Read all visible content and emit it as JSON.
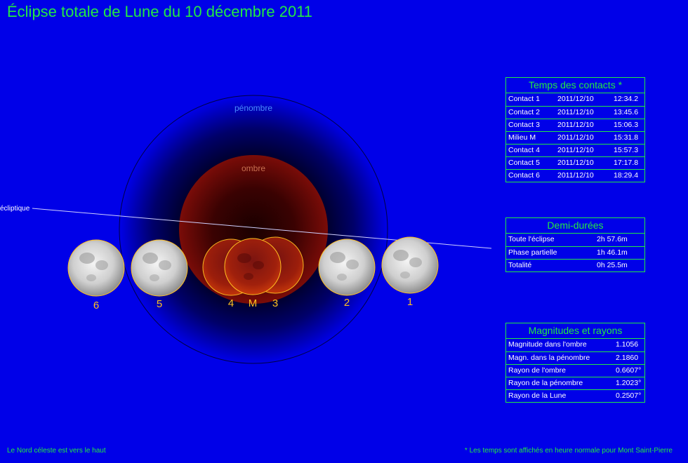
{
  "title": "Éclipse totale de Lune du 10 décembre 2011",
  "diagram": {
    "penumbra_label": "pénombre",
    "umbra_label": "ombre",
    "ecliptic_label": "écliptique",
    "moon_labels": [
      "6",
      "5",
      "4",
      "M",
      "3",
      "2",
      "1"
    ]
  },
  "contacts": {
    "title": "Temps des contacts *",
    "rows": [
      {
        "label": "Contact 1",
        "date": "2011/12/10",
        "time": "12:34.2"
      },
      {
        "label": "Contact 2",
        "date": "2011/12/10",
        "time": "13:45.6"
      },
      {
        "label": "Contact 3",
        "date": "2011/12/10",
        "time": "15:06.3"
      },
      {
        "label": "Milieu M",
        "date": "2011/12/10",
        "time": "15:31.8"
      },
      {
        "label": "Contact 4",
        "date": "2011/12/10",
        "time": "15:57.3"
      },
      {
        "label": "Contact 5",
        "date": "2011/12/10",
        "time": "17:17.8"
      },
      {
        "label": "Contact 6",
        "date": "2011/12/10",
        "time": "18:29.4"
      }
    ]
  },
  "durations": {
    "title": "Demi-durées",
    "rows": [
      {
        "label": "Toute l'éclipse",
        "value": "2h 57.6m"
      },
      {
        "label": "Phase partielle",
        "value": "1h 46.1m"
      },
      {
        "label": "Totalité",
        "value": "0h 25.5m"
      }
    ]
  },
  "magnitudes": {
    "title": "Magnitudes et rayons",
    "rows": [
      {
        "label": "Magnitude dans l'ombre",
        "value": "1.1056"
      },
      {
        "label": "Magn. dans la pénombre",
        "value": "2.1860"
      },
      {
        "label": "Rayon de l'ombre",
        "value": "0.6607°"
      },
      {
        "label": "Rayon de la pénombre",
        "value": "1.2023°"
      },
      {
        "label": "Rayon de la Lune",
        "value": "0.2507°"
      }
    ]
  },
  "footer": {
    "left": "Le Nord céleste est vers le haut",
    "right": "* Les temps sont affichés en heure normale pour Mont Saint-Pierre"
  },
  "colors": {
    "background": "#0000e8",
    "accent": "#22e844",
    "moon_label": "#ffc020",
    "umbra": "#7a0c08",
    "penumbra_label": "#4a8cff",
    "umbra_label": "#c87050"
  }
}
